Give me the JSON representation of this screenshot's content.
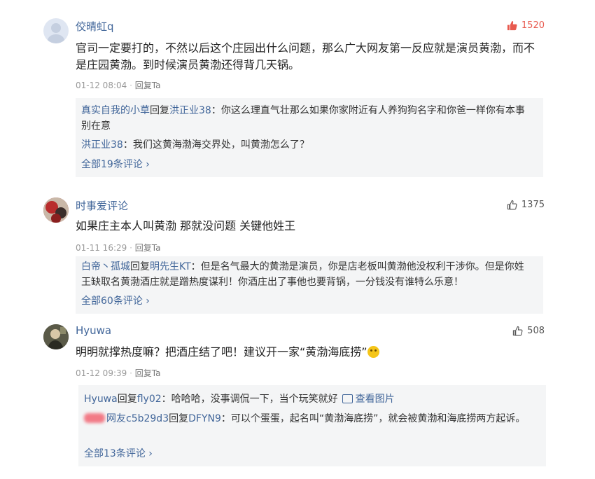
{
  "comments": [
    {
      "user": "佼晴虹q",
      "likes": "1520",
      "text": "官司一定要打的，不然以后这个庄园出什么问题，那么广大网友第一反应就是演员黄渤，而不是庄园黄渤。到时候演员黄渤还得背几天锅。",
      "time": "01-12 08:04",
      "reply_link": "回复Ta",
      "replies": [
        {
          "from": "真实自我的小草",
          "reply_word": "回复",
          "to": "洪正业38",
          "text": "：你这么理直气壮那么如果你家附近有人养狗狗名字和你爸一样你有本事别在意"
        },
        {
          "from": "洪正业38",
          "text": "：我们这黄海渤海交界处，叫黄渤怎么了？"
        }
      ],
      "more": "全部19条评论 ›"
    },
    {
      "user": "时事爱评论",
      "likes": "1375",
      "text": "如果庄主本人叫黄渤 那就没问题 关键他姓王",
      "time": "01-11 16:29",
      "reply_link": "回复Ta",
      "replies": [
        {
          "from": "白帝丶孤城",
          "reply_word": "回复",
          "to": "明先生KT",
          "text": "：但是名气最大的黄渤是演员，你是店老板叫黄渤他没权利干涉你。但是你姓王缺取名黄渤酒庄就是蹭热度谋利！你酒庄出了事他也要背锅，一分钱没有谁特么乐意！"
        }
      ],
      "more": "全部60条评论 ›"
    },
    {
      "user": "Hyuwa",
      "likes": "508",
      "text": "明明就撑热度嘛？把酒庄结了吧！建议开一家“黄渤海底捞”",
      "time": "01-12 09:39",
      "reply_link": "回复Ta",
      "replies": [
        {
          "from": "Hyuwa",
          "reply_word": "回复",
          "to": "fly02",
          "text": "：哈哈哈，没事调侃一下，当个玩笑就好",
          "image_link": "查看图片"
        },
        {
          "from": "网友c5b29d3",
          "reply_word": "回复",
          "to": "DFYN9",
          "text": "：可以个蛋蛋，起名叫“黄渤海底捞”，就会被黄渤和海底捞两方起诉。"
        }
      ],
      "more": "全部13条评论 ›"
    }
  ]
}
